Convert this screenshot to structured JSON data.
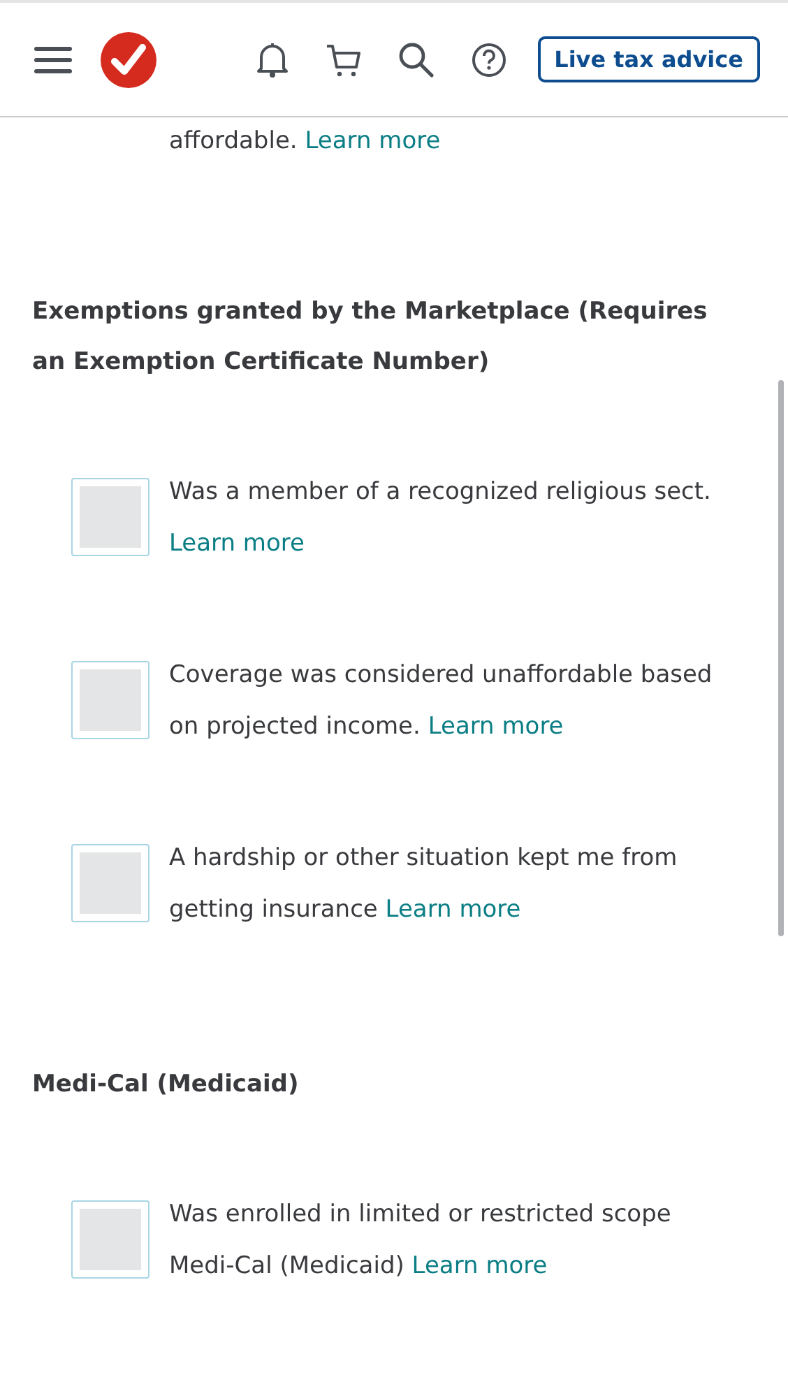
{
  "header": {
    "live_advice_button": "Live tax advice"
  },
  "partial_text": {
    "text": "affordable.",
    "link": "Learn more"
  },
  "sections": [
    {
      "title": "Exemptions granted by the Marketplace (Requires an Exemption Certificate Number)",
      "options": [
        {
          "text": "Was a member of a recognized religious sect.",
          "link": "Learn more",
          "checked": false
        },
        {
          "text": "Coverage was considered unaffordable based on projected income.",
          "link": "Learn more",
          "checked": false
        },
        {
          "text": "A hardship or other situation kept me from getting insurance",
          "link": "Learn more",
          "checked": false
        }
      ]
    },
    {
      "title": "Medi-Cal (Medicaid)",
      "options": [
        {
          "text": "Was enrolled in limited or restricted scope Medi-Cal (Medicaid)",
          "link": "Learn more",
          "checked": false
        }
      ]
    }
  ]
}
